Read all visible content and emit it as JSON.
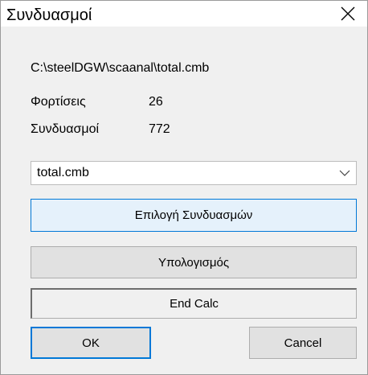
{
  "window": {
    "title": "Συνδυασμοί"
  },
  "info": {
    "path": "C:\\steelDGW\\scaanal\\total.cmb",
    "loads_label": "Φορτίσεις",
    "loads_value": "26",
    "combos_label": "Συνδυασμοί",
    "combos_value": "772"
  },
  "file_select": {
    "value": "total.cmb"
  },
  "buttons": {
    "select_combos": "Επιλογή Συνδυασμών",
    "calculate": "Υπολογισμός",
    "end_calc": "End Calc",
    "ok": "OK",
    "cancel": "Cancel"
  },
  "icons": {
    "close": "close-icon",
    "dropdown": "chevron-down-icon"
  },
  "colors": {
    "accent": "#0078d7",
    "primary_bg": "#e5f1fb",
    "dialog_bg": "#f0f0f0"
  }
}
